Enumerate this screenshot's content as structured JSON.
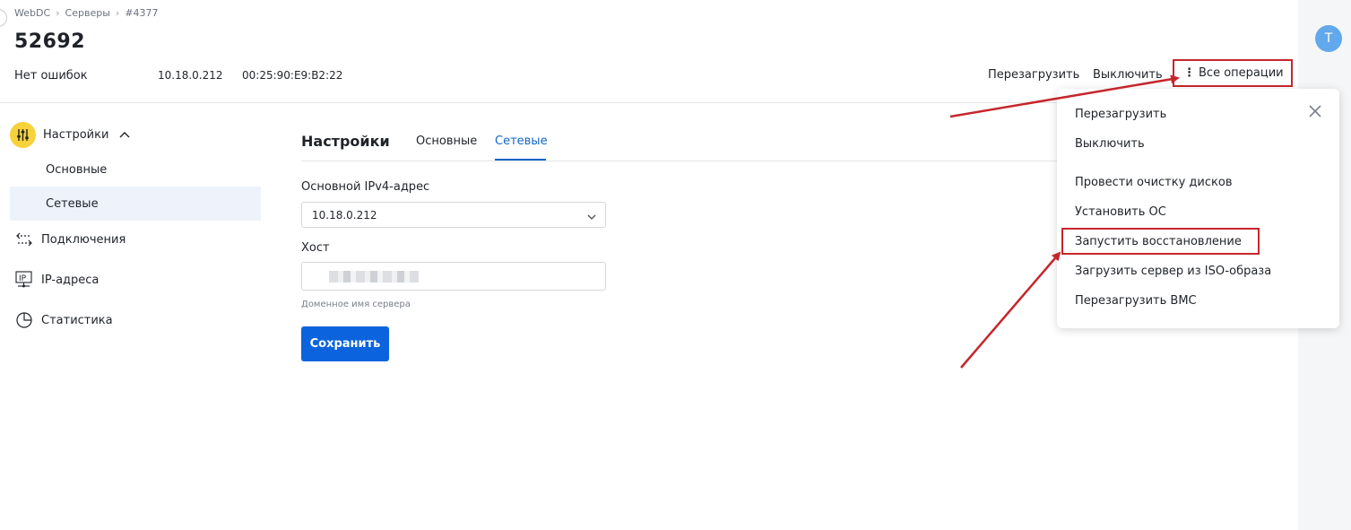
{
  "breadcrumb": [
    "WebDC",
    "Серверы",
    "#4377"
  ],
  "page_title": "52692",
  "server_info": {
    "status": "Нет ошибок",
    "ip": "10.18.0.212",
    "mac": "00:25:90:E9:B2:22"
  },
  "header_actions": {
    "reboot": "Перезагрузить",
    "power_off": "Выключить",
    "all_operations": "Все операции"
  },
  "avatar_letter": "T",
  "sidebar": {
    "settings": "Настройки",
    "settings_sub": [
      "Основные",
      "Сетевые"
    ],
    "connections": "Подключения",
    "ip_addresses": "IP-адреса",
    "statistics": "Статистика",
    "ip_icon_text": "IP"
  },
  "content": {
    "title": "Настройки",
    "tabs": [
      "Основные",
      "Сетевые"
    ],
    "active_tab": "Сетевые",
    "ipv4_label": "Основной IPv4-адрес",
    "ipv4_value": "10.18.0.212",
    "host_label": "Хост",
    "host_hint": "Доменное имя сервера",
    "save_button": "Сохранить"
  },
  "dropdown_menu": {
    "items": [
      "Перезагрузить",
      "Выключить",
      "Провести очистку дисков",
      "Установить ОС",
      "Запустить восстановление",
      "Загрузить сервер из ISO-образа",
      "Перезагрузить BMC"
    ],
    "highlighted": "Запустить восстановление"
  },
  "colors": {
    "accent": "#0b64dd",
    "tab_active": "#1466c8",
    "annotation": "#c6262c",
    "settings_icon_bg": "#f7d23a",
    "avatar_bg": "#62a8ec"
  }
}
